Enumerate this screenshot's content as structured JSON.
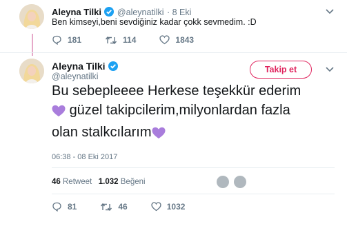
{
  "parent": {
    "name": "Aleyna Tilki",
    "handle": "@aleynatilki",
    "time": "· 8 Eki",
    "text": "Ben kimseyi,beni sevdiğiniz kadar çokk sevmedim. :D",
    "replies": "181",
    "retweets": "114",
    "likes": "1843"
  },
  "tweet": {
    "name": "Aleyna Tilki",
    "handle": "@aleynatilki",
    "follow_label": "Takip et",
    "line1": "Bu sebepleeee Herkese teşekkür ederim",
    "line2": "güzel takipcilerim,milyonlardan fazla",
    "line3": "olan stalkcılarım",
    "timestamp": "06:38 - 08 Eki 2017",
    "retweet_count": "46",
    "retweet_label": "Retweet",
    "like_count": "1.032",
    "like_label": "Beğeni",
    "replies": "81",
    "retweets": "46",
    "likes": "1032"
  },
  "colors": {
    "accent": "#e0245e",
    "heart_emoji": "#a97ddc",
    "verified": "#1da1f2",
    "muted": "#657786"
  },
  "icons": [
    "verified-icon",
    "chevron-down-icon",
    "reply-icon",
    "retweet-icon",
    "like-icon",
    "purple-heart-icon"
  ]
}
